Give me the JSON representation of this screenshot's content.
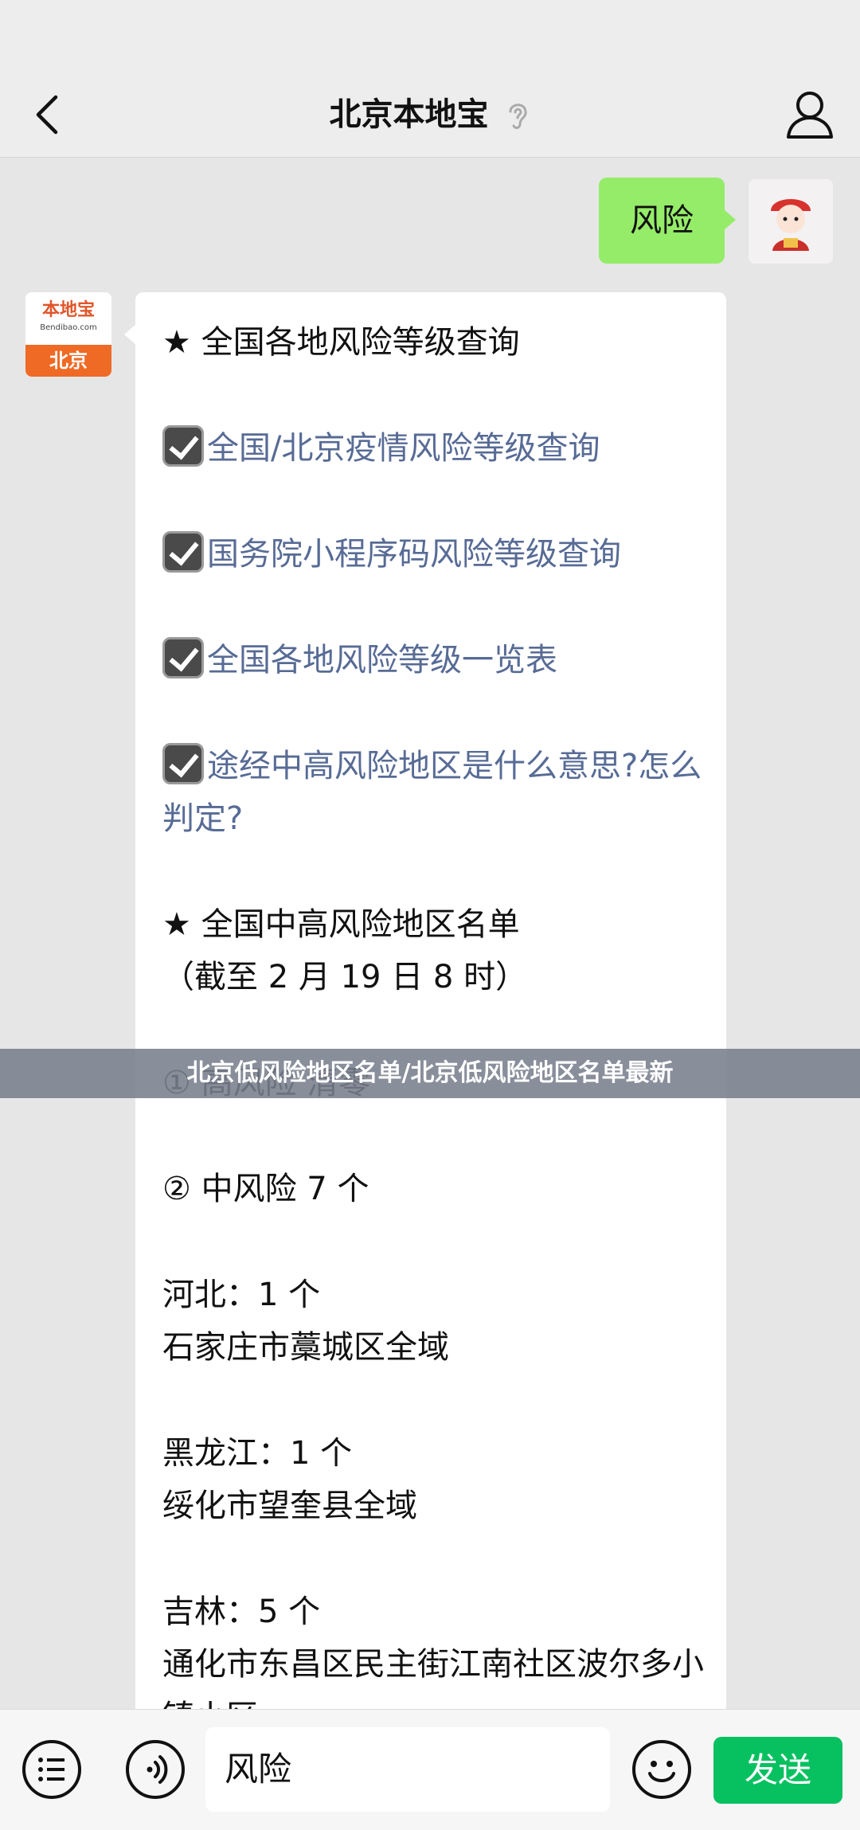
{
  "header": {
    "title": "北京本地宝"
  },
  "messages": {
    "user_text": "风险",
    "bot_avatar": {
      "logo_text": "本地宝",
      "logo_url": "Bendibao.com",
      "city": "北京"
    },
    "bot_lines": {
      "heading1": "★ 全国各地风险等级查询",
      "link1": "全国/北京疫情风险等级查询",
      "link2": "国务院小程序码风险等级查询",
      "link3": "全国各地风险等级一览表",
      "link4": "途经中高风险地区是什么意思?怎么判定?",
      "heading2": "★ 全国中高风险地区名单",
      "date": "（截至 2 月 19 日 8 时）",
      "high_risk": "① 高风险 清零",
      "mid_risk": "② 中风险 7 个",
      "hebei_count": "河北：1 个",
      "hebei_area": "石家庄市藁城区全域",
      "hlj_count": "黑龙江：1 个",
      "hlj_area": "绥化市望奎县全域",
      "jilin_count": "吉林：5 个",
      "jilin_area": "通化市东昌区民主街江南社区波尔多小镇小区"
    }
  },
  "banner": {
    "text": "北京低风险地区名单/北京低风险地区名单最新"
  },
  "input_bar": {
    "input_value": "风险",
    "send_label": "发送"
  },
  "colors": {
    "user_bubble": "#95ec69",
    "send_button": "#07c160",
    "link": "#576b95"
  }
}
